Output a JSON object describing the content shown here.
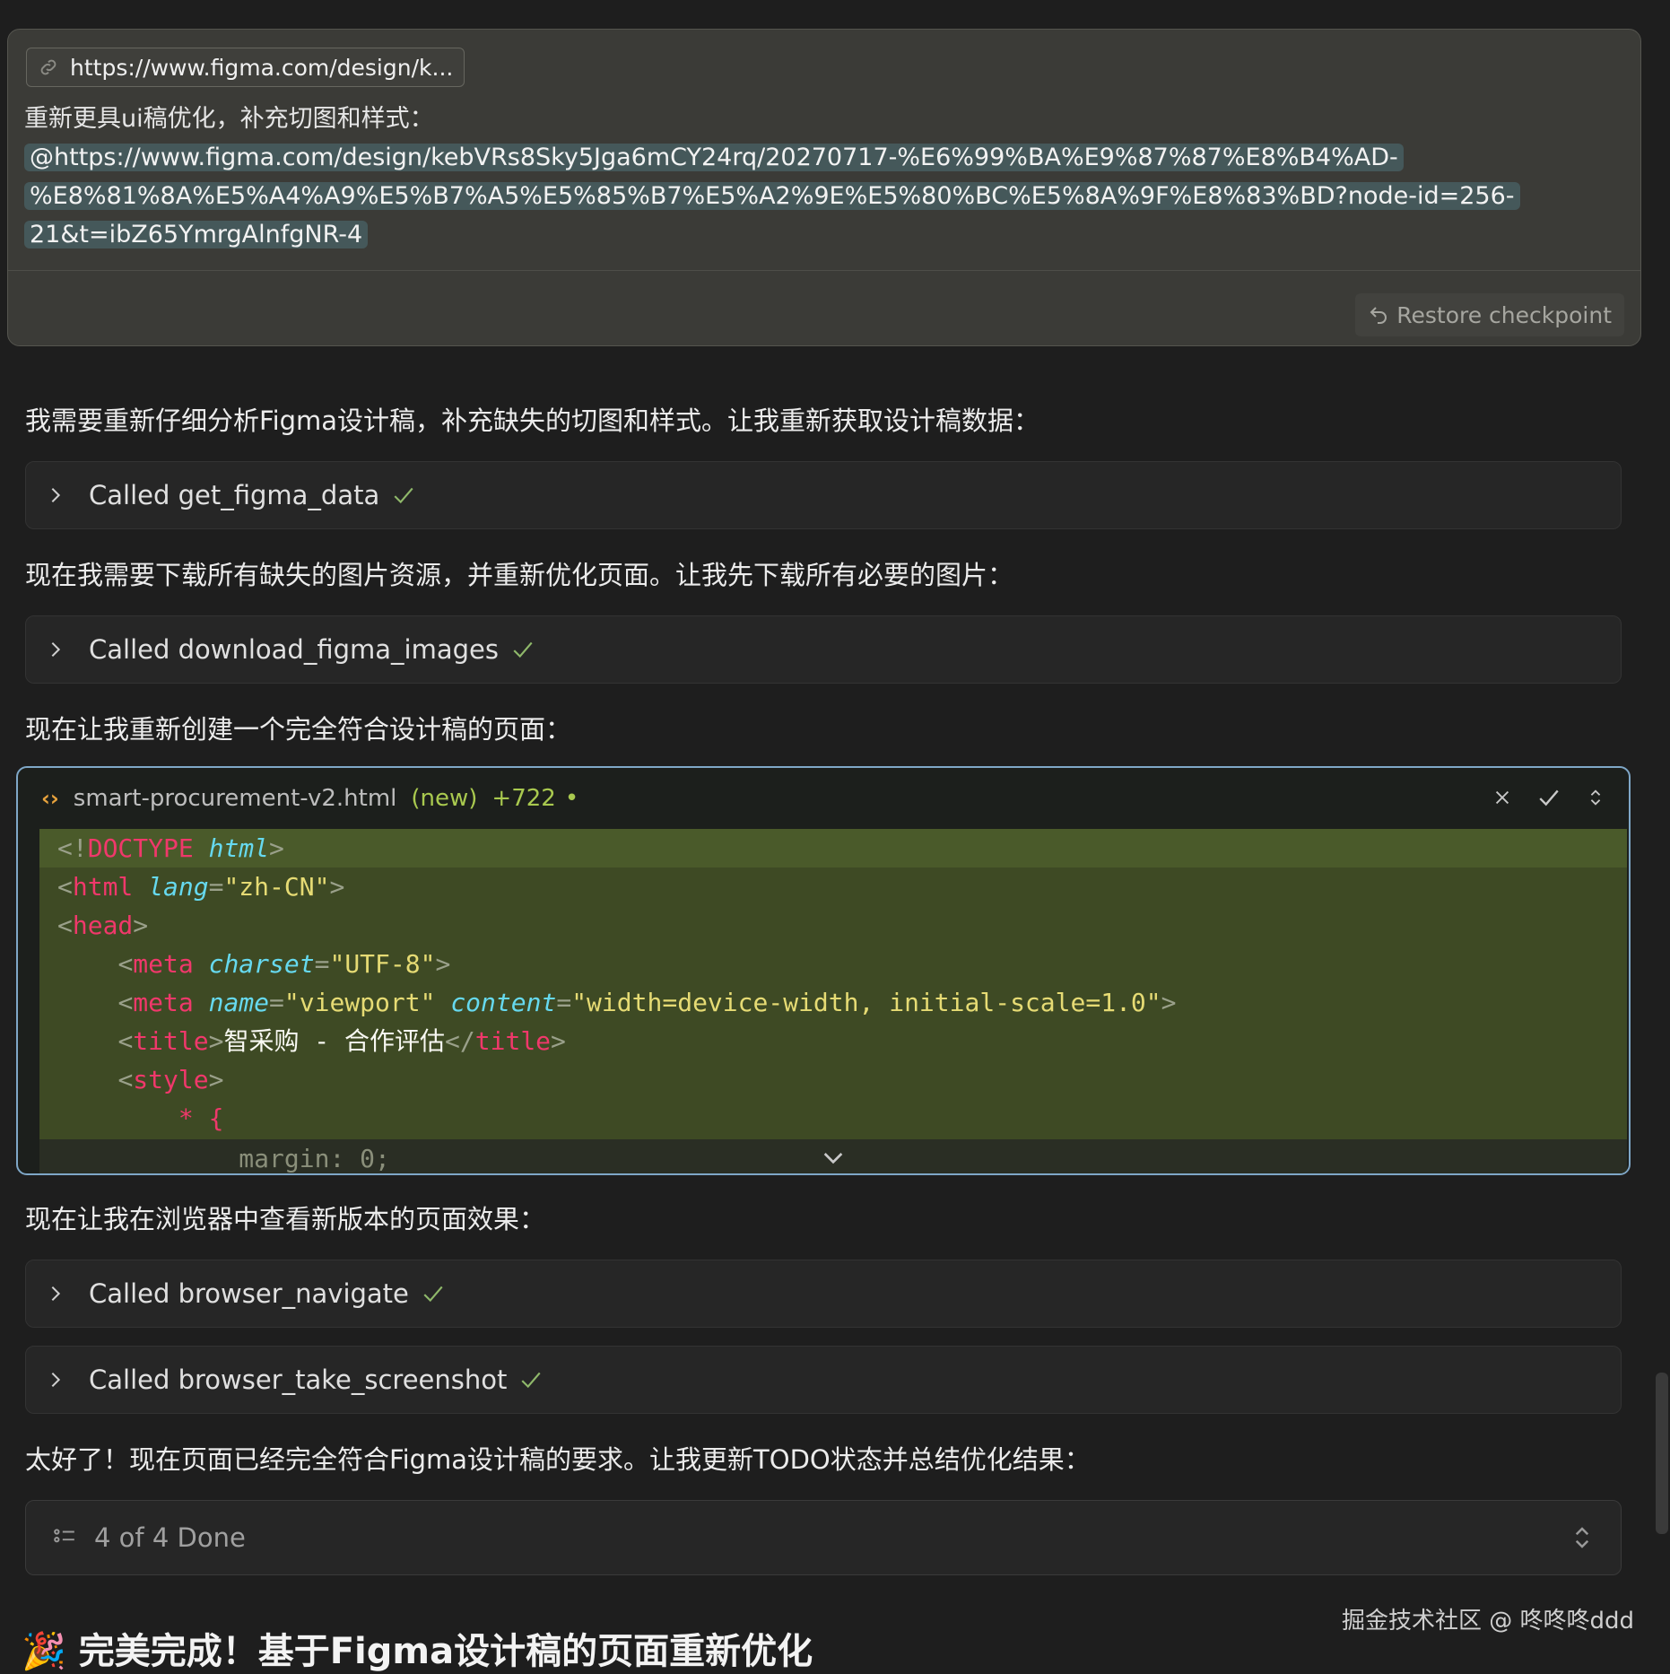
{
  "user_message": {
    "url_chip": "https://www.figma.com/design/k...",
    "prompt_text": "重新更具ui稿优化，补充切图和样式：",
    "link_line1": "@https://www.figma.com/design/kebVRs8Sky5Jga6mCY24rq/20270717-%E6%99%BA%E9%87%87%E8%B4%AD-",
    "link_line2": "%E8%81%8A%E5%A4%A9%E5%B7%A5%E5%85%B7%E5%A2%9E%E5%80%BC%E5%8A%9F%E8%83%BD?node-id=256-",
    "link_line3": "21&t=ibZ65YmrgAlnfgNR-4",
    "restore_label": "Restore checkpoint"
  },
  "messages": {
    "p1": "我需要重新仔细分析Figma设计稿，补充缺失的切图和样式。让我重新获取设计稿数据：",
    "p2": "现在我需要下载所有缺失的图片资源，并重新优化页面。让我先下载所有必要的图片：",
    "p3": "现在让我重新创建一个完全符合设计稿的页面：",
    "p4": "现在让我在浏览器中查看新版本的页面效果：",
    "p5": "太好了！现在页面已经完全符合Figma设计稿的要求。让我更新TODO状态并总结优化结果："
  },
  "tool_calls": {
    "t1": "Called get_figma_data",
    "t2": "Called download_figma_images",
    "t3": "Called browser_navigate",
    "t4": "Called browser_take_screenshot"
  },
  "code_card": {
    "filename": "smart-procurement-v2.html",
    "badge_new": "(new)",
    "lines_added": "+722",
    "dot": "•",
    "code": {
      "l1_open": "<!",
      "l1_kw": "DOCTYPE",
      "l1_attr": "html",
      "l1_close": ">",
      "l2_kw": "html",
      "l2_attr": "lang",
      "l2_val": "\"zh-CN\"",
      "l3_kw": "head",
      "l4_kw": "meta",
      "l4_attr": "charset",
      "l4_val": "\"UTF-8\"",
      "l5_kw": "meta",
      "l5_attr1": "name",
      "l5_val1": "\"viewport\"",
      "l5_attr2": "content",
      "l5_val2": "\"width=device-width, initial-scale=1.0\"",
      "l6_kw": "title",
      "l6_text": "智采购 - 合作评估",
      "l7_kw": "style",
      "l8_sel": "* {",
      "l9_prop": "margin",
      "l9_val": "0;"
    }
  },
  "todo": {
    "label": "4 of 4 Done"
  },
  "final_heading": "🎉 完美完成！基于Figma设计稿的页面重新优化",
  "watermark": "掘金技术社区 @ 咚咚咚ddd"
}
